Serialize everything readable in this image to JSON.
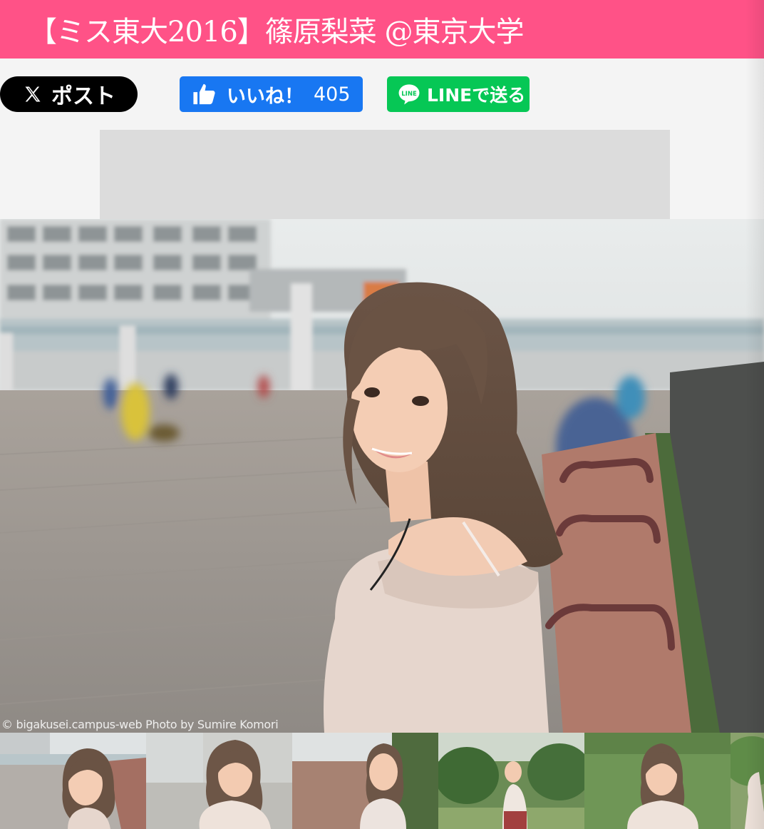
{
  "header": {
    "title": "【ミス東大2016】篠原梨菜 @東京大学"
  },
  "share": {
    "x_label": "ポスト",
    "facebook_label": "いいね！",
    "facebook_count": "405",
    "line_label": "LINEで送る"
  },
  "colors": {
    "title_bar": "#ff5287",
    "x": "#000000",
    "facebook": "#1877f2",
    "line": "#06c755"
  },
  "icons": {
    "x": "x-logo-icon",
    "facebook": "thumbs-up-icon",
    "line": "line-logo-icon",
    "ad": "broken-document-icon"
  },
  "photo": {
    "credit": "© bigakusei.campus-web Photo by Sumire Komori"
  },
  "thumbnails": [
    {
      "label": "photo 1"
    },
    {
      "label": "photo 2"
    },
    {
      "label": "photo 3"
    },
    {
      "label": "photo 4"
    },
    {
      "label": "photo 5"
    },
    {
      "label": "photo 6"
    }
  ]
}
